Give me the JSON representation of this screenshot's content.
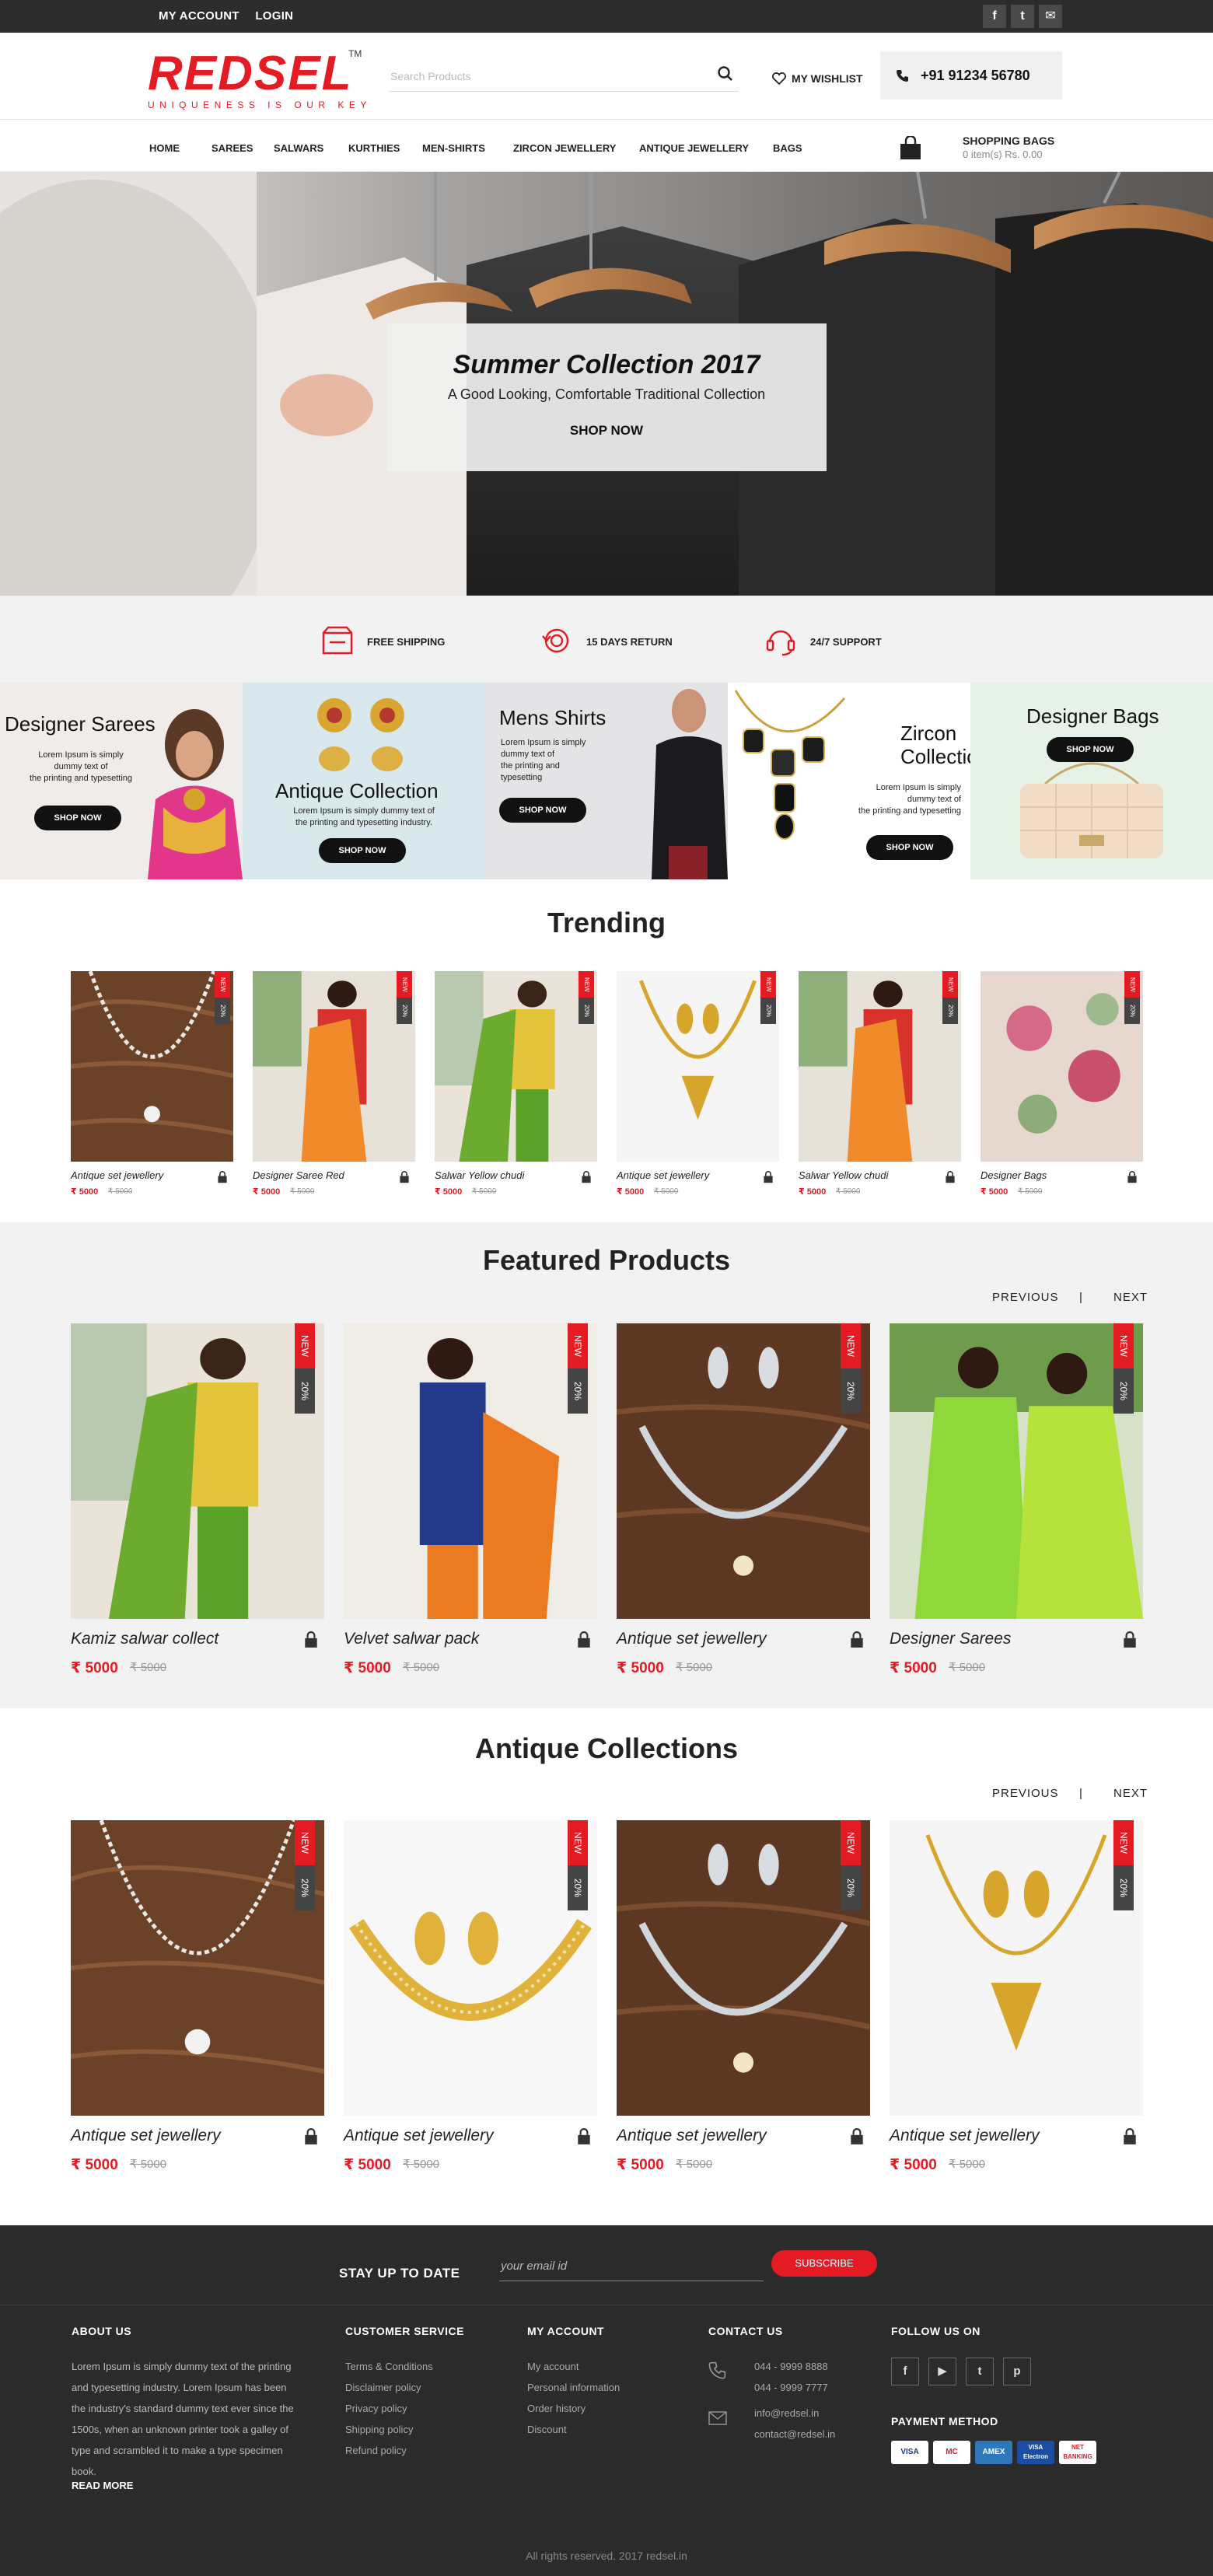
{
  "topbar": {
    "my_account": "MY ACCOUNT",
    "login": "LOGIN",
    "social": [
      "f",
      "t",
      "✉"
    ]
  },
  "header": {
    "brand": "REDSEL",
    "tagline": "UNIQUENESS IS OUR KEY",
    "tm": "TM",
    "search_placeholder": "Search Products",
    "wishlist": "MY WISHLIST",
    "phone": "+91 91234 56780"
  },
  "nav": {
    "items": [
      "HOME",
      "SAREES",
      "SALWARS",
      "KURTHIES",
      "MEN-SHIRTS",
      "ZIRCON JEWELLERY",
      "ANTIQUE JEWELLERY",
      "BAGS"
    ],
    "bag_title": "SHOPPING BAGS",
    "bag_summary": "0 item(s)  Rs. 0.00"
  },
  "hero": {
    "title": "Summer Collection 2017",
    "subtitle": "A Good Looking, Comfortable Traditional Collection",
    "cta": "SHOP NOW"
  },
  "features": [
    "FREE SHIPPING",
    "15 DAYS RETURN",
    "24/7 SUPPORT"
  ],
  "categories": [
    {
      "title": "Designer Sarees",
      "desc": [
        "Lorem Ipsum is simply",
        "dummy text of",
        "the printing and typesetting"
      ],
      "cta": "SHOP NOW"
    },
    {
      "title": "Antique Collection",
      "desc": [
        "Lorem Ipsum is simply dummy text of",
        "the printing and typesetting industry."
      ],
      "cta": "SHOP NOW"
    },
    {
      "title": "Mens Shirts",
      "desc": [
        "Lorem Ipsum is simply",
        "dummy text of",
        "the printing and",
        "typesetting"
      ],
      "cta": "SHOP NOW"
    },
    {
      "title": "Zircon Collection",
      "desc": [
        "Lorem Ipsum is simply",
        "dummy text of",
        "the printing and typesetting"
      ],
      "cta": "SHOP NOW"
    },
    {
      "title": "Designer Bags",
      "desc": [],
      "cta": "SHOP NOW"
    }
  ],
  "trending": {
    "heading": "Trending",
    "badge_new": "NEW",
    "badge_off": "20%",
    "items": [
      {
        "name": "Antique set jewellery",
        "price": "₹ 5000",
        "old": "₹ 5000"
      },
      {
        "name": "Designer Saree Red",
        "price": "₹ 5000",
        "old": "₹ 5000"
      },
      {
        "name": "Salwar Yellow chudi",
        "price": "₹ 5000",
        "old": "₹ 5000"
      },
      {
        "name": "Antique set jewellery",
        "price": "₹ 5000",
        "old": "₹ 5000"
      },
      {
        "name": "Salwar Yellow chudi",
        "price": "₹ 5000",
        "old": "₹ 5000"
      },
      {
        "name": "Designer Bags",
        "price": "₹ 5000",
        "old": "₹ 5000"
      }
    ]
  },
  "featured": {
    "heading": "Featured Products",
    "previous": "PREVIOUS",
    "sep": "|",
    "next": "NEXT",
    "badge_new": "NEW",
    "badge_off": "20%",
    "items": [
      {
        "name": "Kamiz salwar collect",
        "price": "₹ 5000",
        "old": "₹ 5000"
      },
      {
        "name": "Velvet salwar pack",
        "price": "₹ 5000",
        "old": "₹ 5000"
      },
      {
        "name": "Antique set jewellery",
        "price": "₹ 5000",
        "old": "₹ 5000"
      },
      {
        "name": "Designer Sarees",
        "price": "₹ 5000",
        "old": "₹ 5000"
      }
    ]
  },
  "antique": {
    "heading": "Antique Collections",
    "previous": "PREVIOUS",
    "sep": "|",
    "next": "NEXT",
    "badge_new": "NEW",
    "badge_off": "20%",
    "items": [
      {
        "name": "Antique set jewellery",
        "price": "₹ 5000",
        "old": "₹ 5000"
      },
      {
        "name": "Antique set jewellery",
        "price": "₹ 5000",
        "old": "₹ 5000"
      },
      {
        "name": "Antique set jewellery",
        "price": "₹ 5000",
        "old": "₹ 5000"
      },
      {
        "name": "Antique set jewellery",
        "price": "₹ 5000",
        "old": "₹ 5000"
      }
    ]
  },
  "footer": {
    "newsletter_label": "STAY UP TO DATE",
    "email_placeholder": "your email id",
    "subscribe": "SUBSCRIBE",
    "about_heading": "ABOUT US",
    "about_text": "Lorem Ipsum is simply dummy text of the printing and typesetting industry. Lorem Ipsum has been the industry's standard dummy text ever since the 1500s, when an unknown printer took a galley of type and scrambled it to make a type specimen book.",
    "read_more": "READ MORE",
    "customer_service_heading": "CUSTOMER SERVICE",
    "customer_service": [
      "Terms & Conditions",
      "Disclaimer policy",
      "Privacy policy",
      "Shipping policy",
      "Refund policy"
    ],
    "my_account_heading": "MY ACCOUNT",
    "my_account": [
      "My account",
      "Personal information",
      "Order history",
      "Discount"
    ],
    "contact_heading": "CONTACT US",
    "phones": [
      "044 - 9999 8888",
      "044 - 9999 7777"
    ],
    "emails": [
      "info@redsel.in",
      "contact@redsel.in"
    ],
    "follow_heading": "FOLLOW US ON",
    "social": [
      "f",
      "▶",
      "t",
      "p"
    ],
    "payment_heading": "PAYMENT METHOD",
    "payments": [
      "VISA",
      "MC",
      "AMEX",
      "VISA Electron",
      "NET BANKING"
    ],
    "copyright": "All rights reserved. 2017 redsel.in"
  },
  "colors": {
    "accent": "#e41b23",
    "dark": "#2b2b2b",
    "light": "#f2f2f2"
  }
}
